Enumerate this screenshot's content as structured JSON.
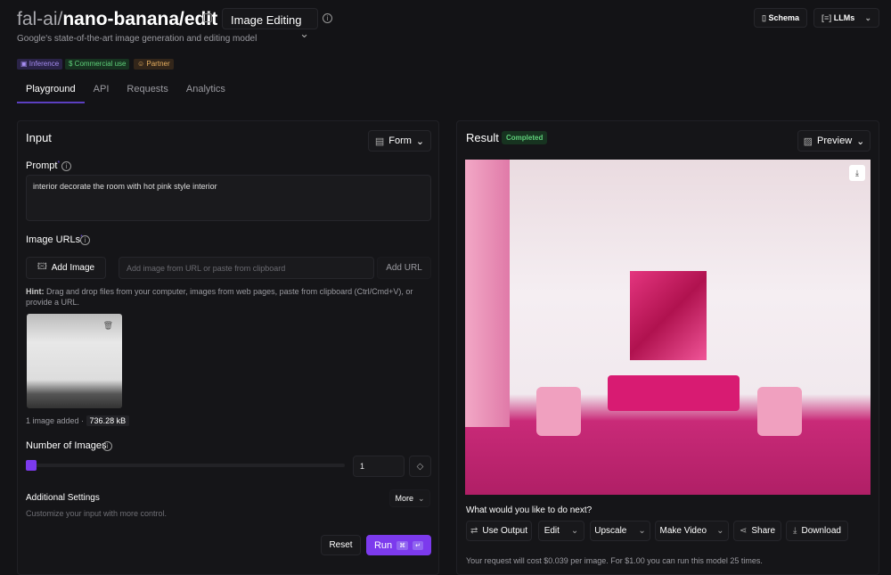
{
  "header": {
    "title_prefix": "fal-ai/",
    "title_main": "nano-banana/edit",
    "category": "Image Editing",
    "subtitle": "Google's state-of-the-art image generation and editing model",
    "badges": [
      {
        "label": "Inference",
        "color": "#a48cf0"
      },
      {
        "label": "Commercial use",
        "color": "#5fd07a"
      },
      {
        "label": "Partner",
        "color": "#e8b060"
      }
    ],
    "schema": "Schema",
    "llms": "LLMs"
  },
  "tabs": [
    "Playground",
    "API",
    "Requests",
    "Analytics"
  ],
  "input": {
    "title": "Input",
    "mode": "Form",
    "prompt_label": "Prompt",
    "prompt_value": "interior decorate the room with hot pink style interior",
    "image_urls_label": "Image URLs",
    "add_image": "Add Image",
    "url_placeholder": "Add image from URL or paste from clipboard",
    "add_url": "Add URL",
    "hint_bold": "Hint:",
    "hint": " Drag and drop files from your computer, images from web pages, paste from clipboard (Ctrl/Cmd+V), or provide a URL.",
    "images_added": "1 image added",
    "file_size": "736.28 kB",
    "num_images_label": "Number of Images",
    "num_images_value": "1",
    "slider_fraction": 0,
    "additional_title": "Additional Settings",
    "additional_sub": "Customize your input with more control.",
    "more": "More",
    "reset": "Reset",
    "run": "Run",
    "run_keys": [
      "⌘",
      "↵"
    ]
  },
  "result": {
    "title": "Result",
    "status": "Completed",
    "status_color": "#5fd07a",
    "view": "Preview",
    "next_label": "What would you like to do next?",
    "actions": [
      "Use Output",
      "Edit",
      "Upscale",
      "Make Video",
      "Share",
      "Download"
    ],
    "cost_note": "Your request will cost $0.039 per image. For $1.00 you can run this model 25 times."
  },
  "colors": {
    "accent": "#7c3aed",
    "background": "#131316"
  }
}
